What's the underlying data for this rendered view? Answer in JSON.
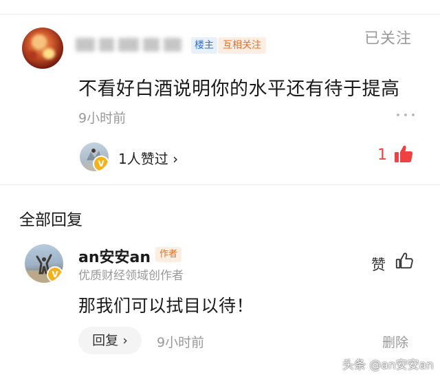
{
  "comment": {
    "author_tag": "楼主",
    "relation_tag": "互相关注",
    "follow_status": "已关注",
    "text": "不看好白酒说明你的水平还有待于提高",
    "time": "9小时前",
    "likers_text": "1人赞过 ›",
    "like_count": "1",
    "colors": {
      "like_red": "#f04142",
      "author_tag_blue": "#2f6fd1",
      "relation_tag_orange": "#e3712c"
    }
  },
  "replies_section": {
    "title": "全部回复"
  },
  "reply": {
    "name": "an安安an",
    "author_badge": "作者",
    "verified_badge": "V",
    "description": "优质财经领域创作者",
    "like_label": "赞",
    "text": "那我们可以拭目以待！",
    "reply_button": "回复 ›",
    "time": "9小时前",
    "delete_label": "删除"
  },
  "watermark": "头条 @an安安an",
  "icons": [
    "more-icon",
    "thumbs-up-filled-icon",
    "thumbs-up-outline-icon",
    "verified-badge-icon"
  ]
}
